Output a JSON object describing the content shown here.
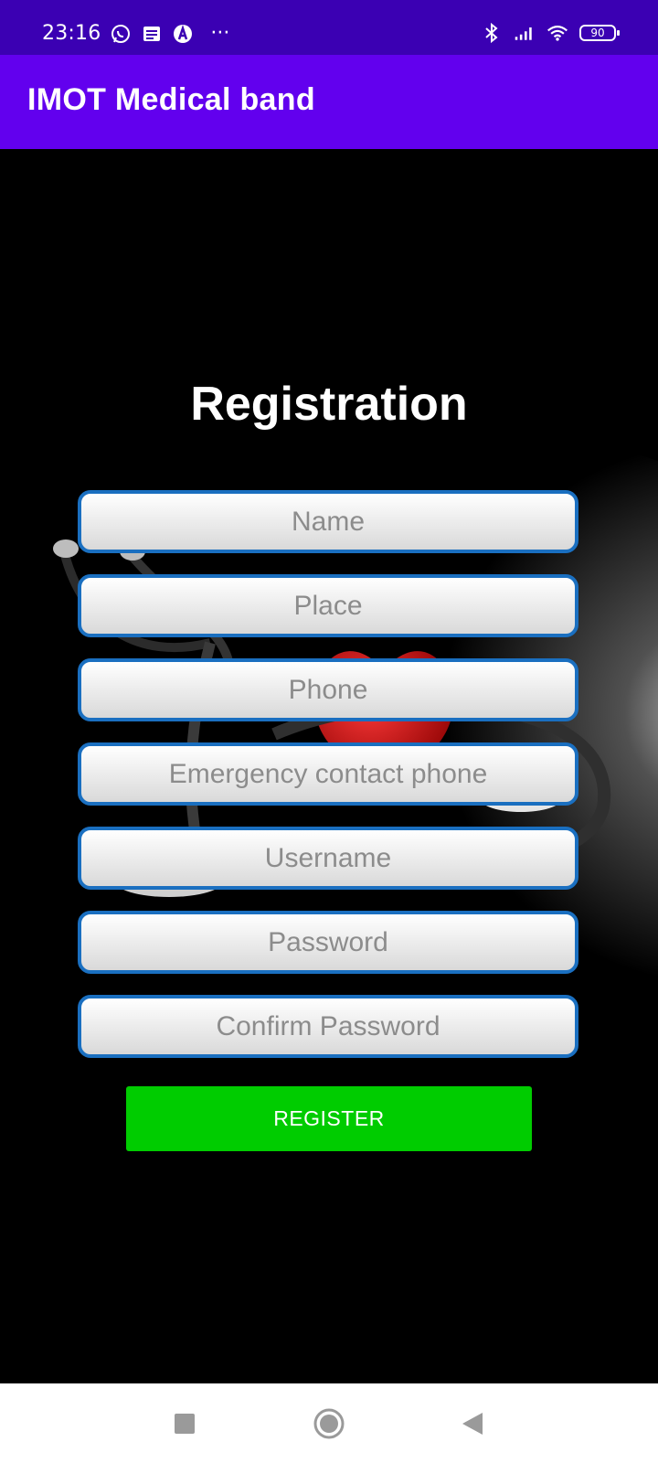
{
  "status_bar": {
    "time": "23:16",
    "more_indicator": "···",
    "battery_level": "90",
    "icons": [
      "whatsapp-icon",
      "message-icon",
      "app-icon",
      "bluetooth-icon",
      "signal-icon",
      "wifi-icon",
      "battery-icon"
    ]
  },
  "app_bar": {
    "title": "IMOT Medical band",
    "color": "#6200ee"
  },
  "form": {
    "heading": "Registration",
    "fields": [
      {
        "placeholder": "Name"
      },
      {
        "placeholder": "Place"
      },
      {
        "placeholder": "Phone"
      },
      {
        "placeholder": "Emergency contact phone"
      },
      {
        "placeholder": "Username"
      },
      {
        "placeholder": "Password"
      },
      {
        "placeholder": "Confirm Password"
      }
    ],
    "field_border_color": "#1a6fc0",
    "submit_label": "REGISTER",
    "submit_color": "#00cc00"
  },
  "nav_bar": {
    "buttons": [
      "recents-button",
      "home-button",
      "back-button"
    ]
  }
}
